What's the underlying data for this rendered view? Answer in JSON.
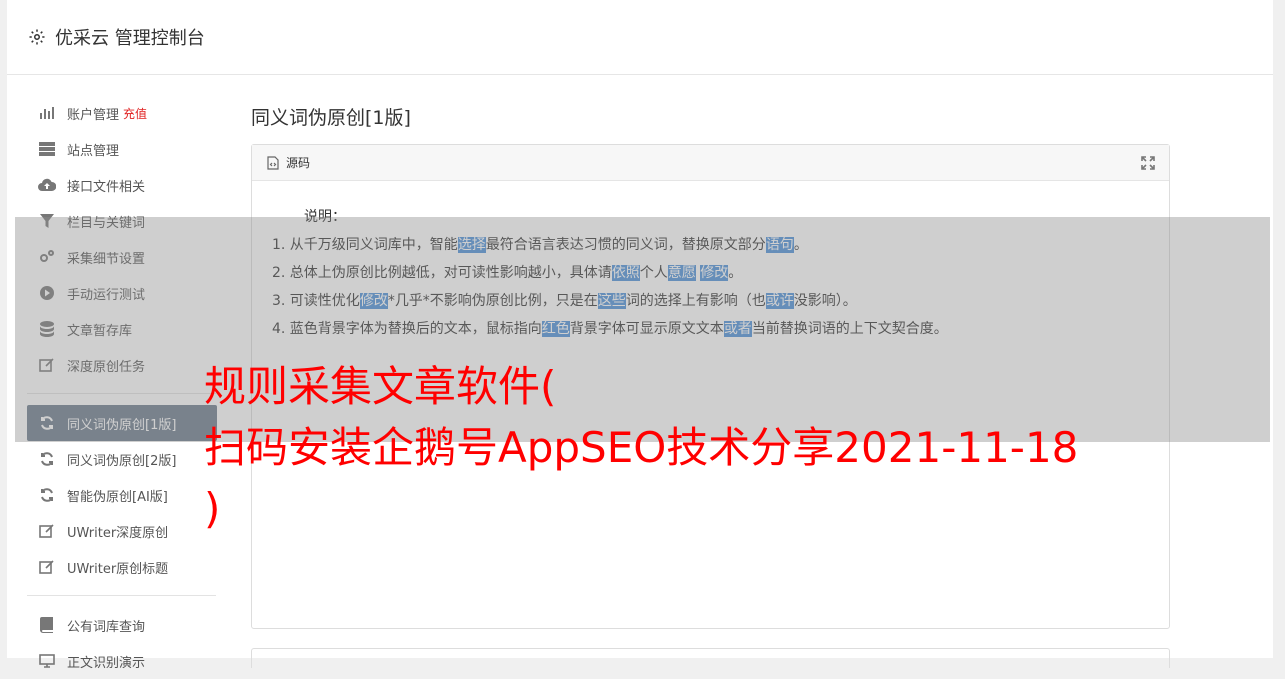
{
  "header": {
    "title": "优采云 管理控制台"
  },
  "sidebar": {
    "group1": [
      {
        "label": "账户管理",
        "extra": "充值",
        "icon": "bar-chart-icon"
      },
      {
        "label": "站点管理",
        "icon": "server-icon"
      },
      {
        "label": "接口文件相关",
        "icon": "cloud-upload-icon"
      },
      {
        "label": "栏目与关键词",
        "icon": "filter-icon"
      },
      {
        "label": "采集细节设置",
        "icon": "gears-icon"
      },
      {
        "label": "手动运行测试",
        "icon": "play-circle-icon"
      },
      {
        "label": "文章暂存库",
        "icon": "database-icon"
      },
      {
        "label": "深度原创任务",
        "icon": "edit-icon"
      }
    ],
    "group2": [
      {
        "label": "同义词伪原创[1版]",
        "icon": "refresh-icon",
        "active": true
      },
      {
        "label": "同义词伪原创[2版]",
        "icon": "refresh-icon"
      },
      {
        "label": "智能伪原创[AI版]",
        "icon": "refresh-icon"
      },
      {
        "label": "UWriter深度原创",
        "icon": "edit-icon"
      },
      {
        "label": "UWriter原创标题",
        "icon": "edit-icon"
      }
    ],
    "group3": [
      {
        "label": "公有词库查询",
        "icon": "book-icon"
      },
      {
        "label": "正文识别演示",
        "icon": "desktop-icon"
      }
    ]
  },
  "main": {
    "page_title": "同义词伪原创[1版]",
    "panel_label": "源码",
    "note": "说明：",
    "items": [
      [
        "1. 从千万级同义词库中，智能",
        "选择",
        "最符合语言表达习惯的同义词，替换原文部分",
        "语句",
        "。"
      ],
      [
        "2. 总体上伪原创比例越低，对可读性影响越小，具体请",
        "依照",
        "个人",
        "意愿",
        " ",
        "修改",
        "。"
      ],
      [
        "3. 可读性优化",
        "修改",
        "*几乎*不影响伪原创比例，只是在",
        "这些",
        "词的选择上有影响（也",
        "或许",
        "没影响）。"
      ],
      [
        "4. 蓝色背景字体为替换后的文本，鼠标指向",
        "红色",
        "背景字体可显示原文文本",
        "或者",
        "当前替换词语的上下文契合度。"
      ]
    ]
  },
  "overlay": {
    "line1": "规则采集文章软件(",
    "line2": "扫码安装企鹅号AppSEO技术分享2021-11-18",
    "line3": ")"
  },
  "colors": {
    "active_nav": "#6b7b8c",
    "highlight": "#4a90d9",
    "overlay_text": "#ff0000",
    "recharge": "#e02020"
  }
}
